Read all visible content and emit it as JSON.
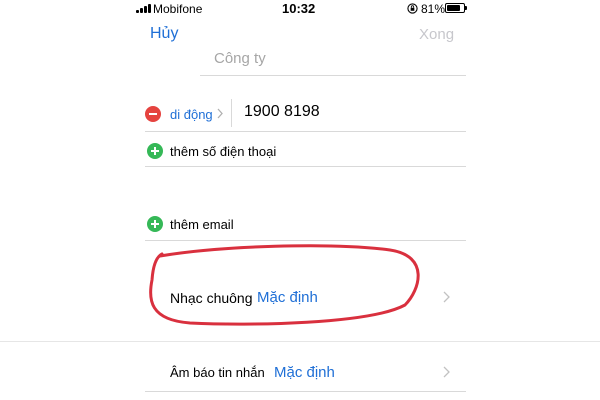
{
  "status_bar": {
    "carrier": "Mobifone",
    "time": "10:32",
    "battery_percent": "81%",
    "battery_level": 0.81,
    "icons": [
      "signal-icon",
      "orientation-lock-icon",
      "battery-icon"
    ]
  },
  "nav": {
    "cancel_label": "Hủy",
    "done_label": "Xong"
  },
  "fields": {
    "company_placeholder": "Công ty"
  },
  "phone": {
    "type_label": "di động",
    "number": "1900 8198",
    "add_phone_label": "thêm số điện thoại"
  },
  "email": {
    "add_email_label": "thêm email"
  },
  "ringtone": {
    "label": "Nhạc chuông",
    "value": "Mặc định"
  },
  "text_tone": {
    "label": "Âm báo tin nhắn",
    "value": "Mặc định"
  },
  "colors": {
    "accent_blue": "#1f6fd6",
    "delete_red": "#e5433f",
    "add_green": "#35b857",
    "annotation_red": "#d9303e",
    "disabled_gray": "#c7c7cc"
  }
}
